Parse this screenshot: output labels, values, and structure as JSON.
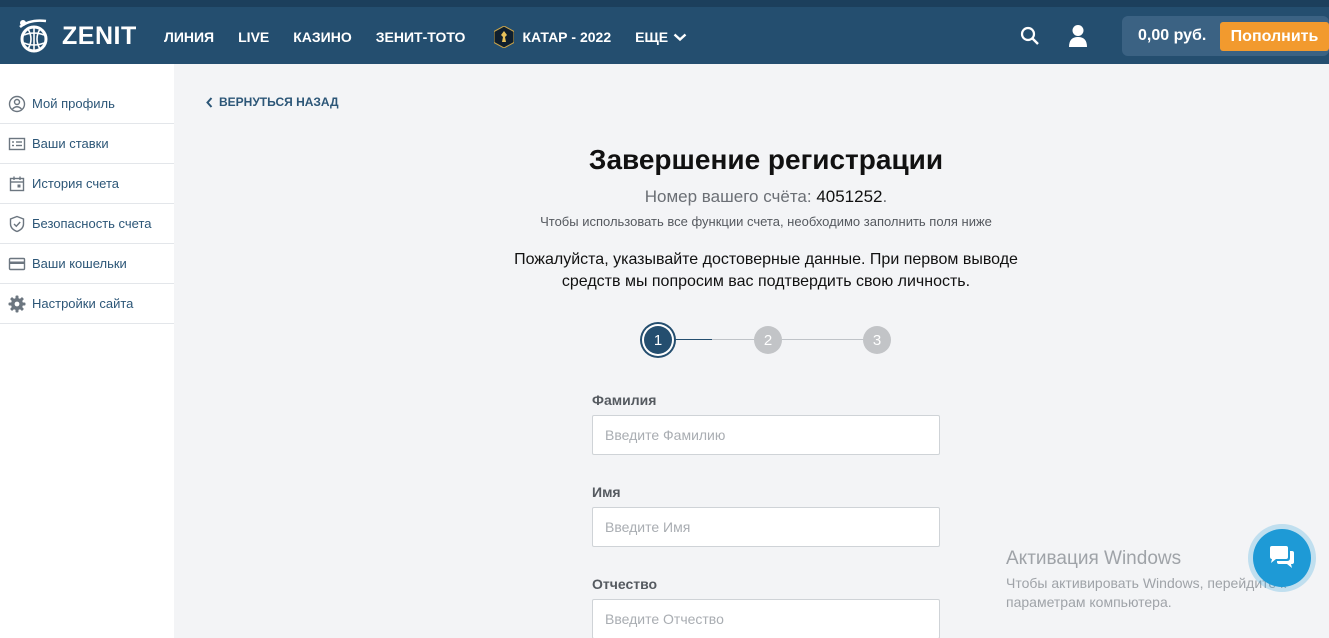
{
  "header": {
    "logo_text": "ZENIT",
    "nav": [
      {
        "label": "ЛИНИЯ"
      },
      {
        "label": "LIVE"
      },
      {
        "label": "КАЗИНО"
      },
      {
        "label": "ЗЕНИТ-ТОТО"
      },
      {
        "label": "КАТАР - 2022",
        "icon": "qatar-cup-icon"
      },
      {
        "label": "ЕЩЕ",
        "icon": "chevron-down-icon"
      }
    ],
    "balance": "0,00 руб.",
    "topup_label": "Пополнить"
  },
  "sidebar": {
    "items": [
      {
        "label": "Мой профиль",
        "icon": "profile-icon"
      },
      {
        "label": "Ваши ставки",
        "icon": "bets-icon"
      },
      {
        "label": "История счета",
        "icon": "calendar-icon"
      },
      {
        "label": "Безопасность счета",
        "icon": "shield-icon"
      },
      {
        "label": "Ваши кошельки",
        "icon": "wallet-icon"
      },
      {
        "label": "Настройки сайта",
        "icon": "gear-icon"
      }
    ]
  },
  "main": {
    "back_label": "ВЕРНУТЬСЯ НАЗАД",
    "title": "Завершение регистрации",
    "account_prefix": "Номер вашего счёта: ",
    "account_number": "4051252",
    "account_suffix": ".",
    "hint": "Чтобы использовать все функции счета, необходимо заполнить поля ниже",
    "notice_line1": "Пожалуйста, указывайте достоверные данные. При первом выводе",
    "notice_line2": "средств мы попросим вас подтвердить свою личность.",
    "steps": [
      "1",
      "2",
      "3"
    ],
    "current_step": 1,
    "fields": [
      {
        "label": "Фамилия",
        "placeholder": "Введите Фамилию",
        "value": ""
      },
      {
        "label": "Имя",
        "placeholder": "Введите Имя",
        "value": ""
      },
      {
        "label": "Отчество",
        "placeholder": "Введите Отчество",
        "value": ""
      }
    ]
  },
  "watermark": {
    "title": "Активация Windows",
    "line1": "Чтобы активировать Windows, перейдите к",
    "line2": "параметрам компьютера."
  },
  "colors": {
    "header_bg": "#244e6f",
    "accent_orange": "#f29a2e",
    "link": "#2c5677",
    "chat": "#1e9ad6"
  }
}
